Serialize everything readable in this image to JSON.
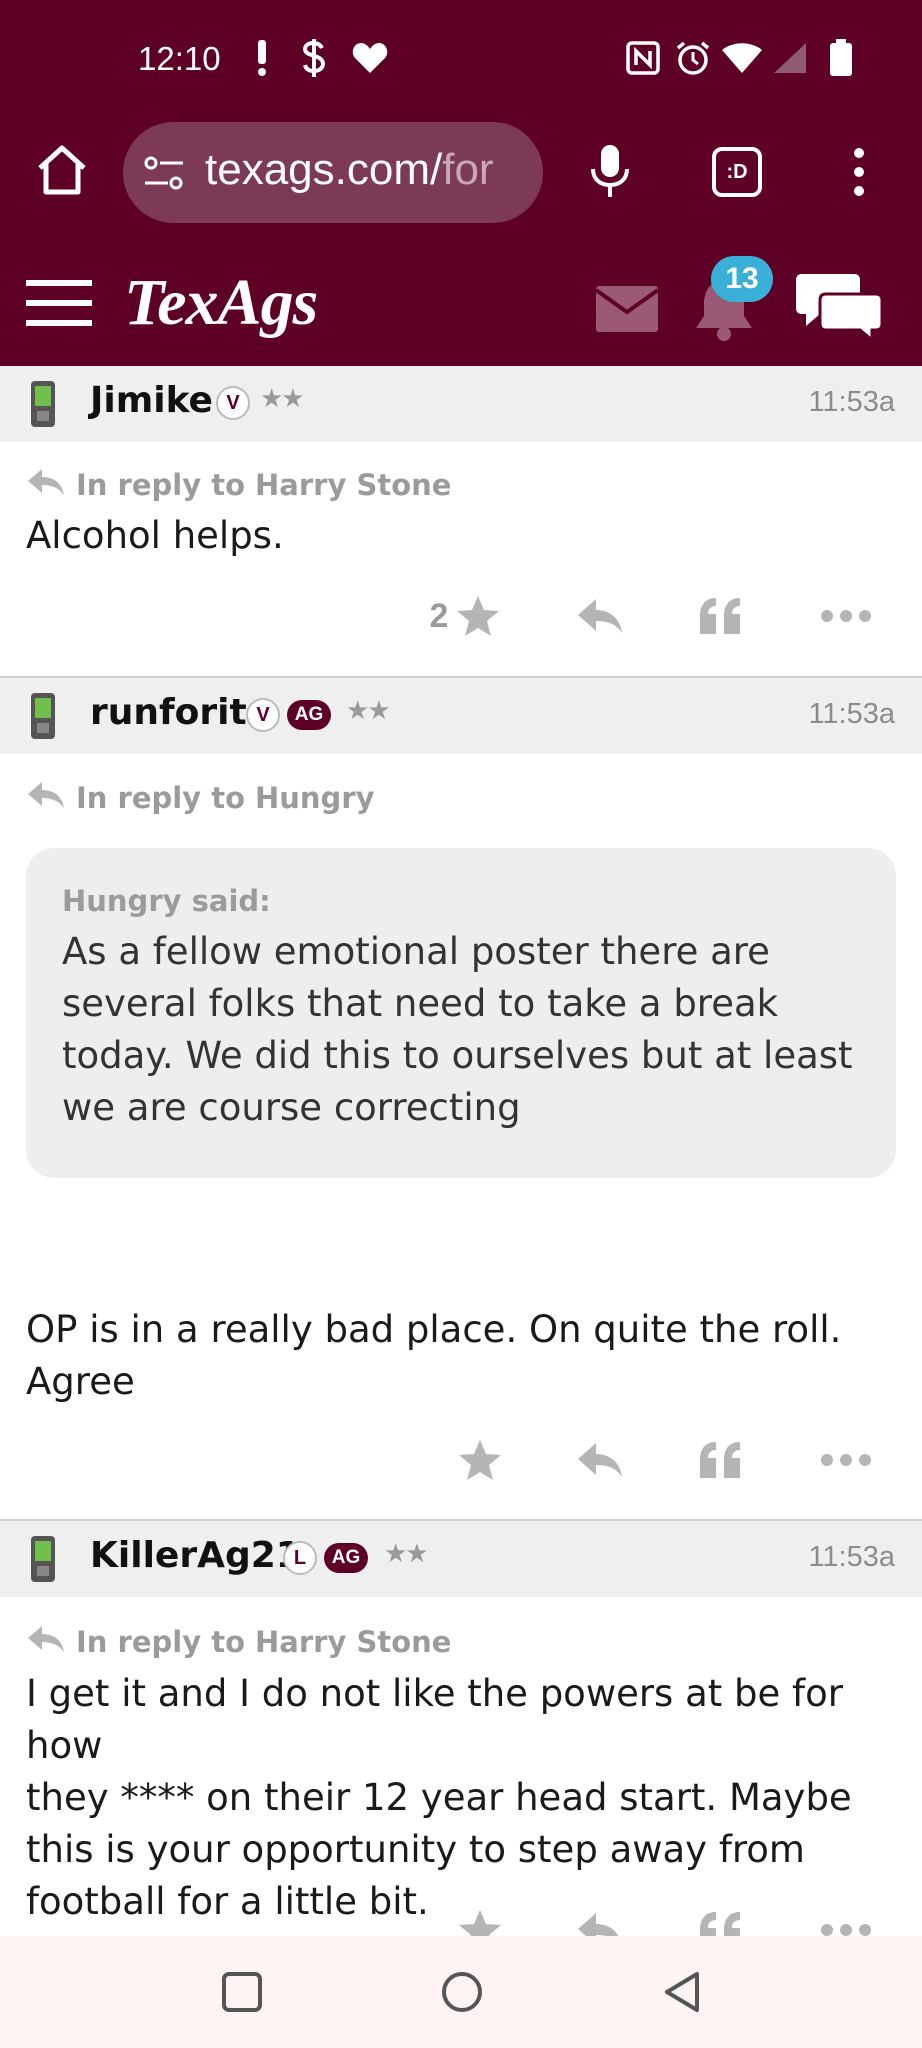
{
  "status_bar": {
    "time": "12:10",
    "icons": [
      "alert-icon",
      "dollar-icon",
      "heart-icon",
      "nfc-icon",
      "alarm-icon",
      "wifi-icon",
      "signal-icon",
      "battery-icon"
    ]
  },
  "browser": {
    "url_visible": "texags.com/",
    "url_faded": "for",
    "tab_switcher_label": ":D"
  },
  "site": {
    "logo": "TexAgs",
    "notification_count": "13",
    "brand_color": "#5e0026",
    "badge_color": "#3ab0d8"
  },
  "posts": [
    {
      "username": "Jimike",
      "badges": [
        "V"
      ],
      "rank": "★★",
      "time": "11:53a",
      "reply_prefix": "In reply to",
      "reply_to": "Harry Stone",
      "body": [
        "Alcohol helps."
      ],
      "star_count": "2"
    },
    {
      "username": "runforit",
      "badges": [
        "V",
        "AG"
      ],
      "rank": "★★",
      "time": "11:53a",
      "reply_prefix": "In reply to",
      "reply_to": "Hungry",
      "quote_author": "Hungry said:",
      "quote_text": [
        "As a fellow emotional poster there are",
        "several folks that need to take a break",
        "today. We did this to ourselves but at least",
        "we are course correcting"
      ],
      "body": [
        "OP is in a really bad place. On quite the roll.",
        "Agree"
      ]
    },
    {
      "username": "KillerAg21",
      "badges": [
        "L",
        "AG"
      ],
      "rank": "★★",
      "time": "11:53a",
      "reply_prefix": "In reply to",
      "reply_to": "Harry Stone",
      "body": [
        "I get it and I do not like the powers at be for how",
        "they **** on their 12 year head start. Maybe",
        "this is your opportunity to step away from",
        "football for a little bit."
      ]
    }
  ]
}
